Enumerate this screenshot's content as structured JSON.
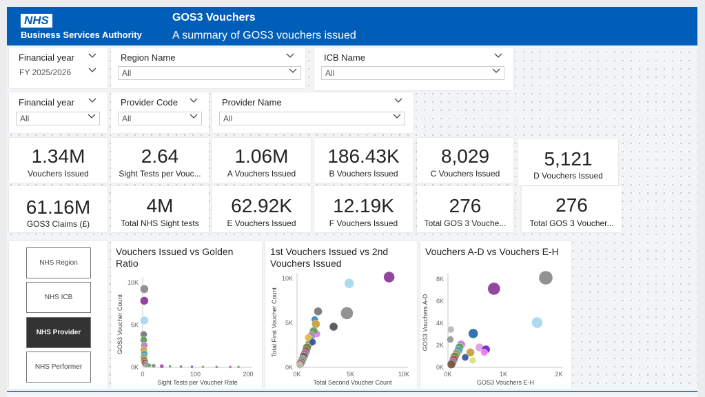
{
  "header": {
    "logo": "NHS",
    "org": "Business Services Authority",
    "title": "GOS3 Vouchers",
    "subtitle": "A summary of GOS3 vouchers issued"
  },
  "slicers_row1": [
    {
      "label": "Financial year",
      "value": "FY 2025/2026"
    },
    {
      "label": "Region Name",
      "value": "All"
    },
    {
      "label": "ICB Name",
      "value": "All"
    }
  ],
  "slicers_row2": [
    {
      "label": "Financial year",
      "value": "All"
    },
    {
      "label": "Provider Code",
      "value": "All"
    },
    {
      "label": "Provider Name",
      "value": "All"
    }
  ],
  "kpis_row1": [
    {
      "value": "1.34M",
      "label": "Vouchers Issued"
    },
    {
      "value": "2.64",
      "label": "Sight Tests per Vouc..."
    },
    {
      "value": "1.06M",
      "label": "A Vouchers Issued"
    },
    {
      "value": "186.43K",
      "label": "B Vouchers Issued"
    },
    {
      "value": "8,029",
      "label": "C Vouchers Issued"
    },
    {
      "value": "5,121",
      "label": "D Vouchers Issued"
    }
  ],
  "kpis_row2": [
    {
      "value": "61.16M",
      "label": "GOS3 Claims (£)"
    },
    {
      "value": "4M",
      "label": "Total NHS Sight tests"
    },
    {
      "value": "62.92K",
      "label": "E Vouchers Issued"
    },
    {
      "value": "12.19K",
      "label": "F Vouchers Issued"
    },
    {
      "value": "276",
      "label": "Total GOS 3 Vouche..."
    },
    {
      "value": "276",
      "label": "Total GOS 3 Voucher..."
    }
  ],
  "nav": {
    "buttons": [
      "NHS Region",
      "NHS ICB",
      "NHS Provider",
      "NHS Performer"
    ],
    "active": "NHS Provider"
  },
  "chart_data": [
    {
      "type": "scatter",
      "title": "Vouchers Issued vs Golden Ratio",
      "xlabel": "Sight Tests per Voucher Rate",
      "ylabel": "GOS3 Voucher Count",
      "xlim": [
        0,
        200
      ],
      "ylim": [
        0,
        11000
      ],
      "xticks": [
        "0",
        "100",
        "200"
      ],
      "yticks": [
        "0K",
        "5K",
        "10K"
      ],
      "points": [
        {
          "x": 3,
          "y": 10000,
          "r": 6,
          "c": "#8c8c8c"
        },
        {
          "x": 3,
          "y": 8500,
          "r": 6,
          "c": "#8e3b9a"
        },
        {
          "x": 3,
          "y": 6000,
          "r": 6,
          "c": "#a8d8f0"
        },
        {
          "x": 2,
          "y": 4200,
          "r": 5,
          "c": "#7a7a7a"
        },
        {
          "x": 2,
          "y": 3500,
          "r": 5,
          "c": "#5aa05a"
        },
        {
          "x": 3,
          "y": 2800,
          "r": 5,
          "c": "#c080c0"
        },
        {
          "x": 2,
          "y": 2200,
          "r": 5,
          "c": "#d0a040"
        },
        {
          "x": 3,
          "y": 1700,
          "r": 5,
          "c": "#4aa0c0"
        },
        {
          "x": 2,
          "y": 1300,
          "r": 5,
          "c": "#a0a070"
        },
        {
          "x": 3,
          "y": 900,
          "r": 5,
          "c": "#6a8a40"
        },
        {
          "x": 4,
          "y": 600,
          "r": 5,
          "c": "#b05050"
        },
        {
          "x": 5,
          "y": 400,
          "r": 4,
          "c": "#777"
        },
        {
          "x": 8,
          "y": 300,
          "r": 4,
          "c": "#9a9a9a"
        },
        {
          "x": 12,
          "y": 250,
          "r": 3,
          "c": "#6a6"
        },
        {
          "x": 20,
          "y": 200,
          "r": 3,
          "c": "#888"
        },
        {
          "x": 35,
          "y": 150,
          "r": 3,
          "c": "#a5a"
        },
        {
          "x": 50,
          "y": 120,
          "r": 2,
          "c": "#5a5"
        },
        {
          "x": 70,
          "y": 100,
          "r": 2,
          "c": "#777"
        },
        {
          "x": 90,
          "y": 80,
          "r": 2,
          "c": "#66a"
        },
        {
          "x": 110,
          "y": 70,
          "r": 2,
          "c": "#8a5"
        },
        {
          "x": 135,
          "y": 60,
          "r": 2,
          "c": "#888"
        },
        {
          "x": 160,
          "y": 60,
          "r": 2,
          "c": "#a6c"
        },
        {
          "x": 175,
          "y": 50,
          "r": 2,
          "c": "#6a6"
        }
      ]
    },
    {
      "type": "scatter",
      "title": "1st Vouchers Issued vs 2nd Vouchers Issued",
      "xlabel": "Total Second Voucher Count",
      "ylabel": "Total First Voucher Count",
      "xlim": [
        0,
        10000
      ],
      "ylim": [
        0,
        10000
      ],
      "xticks": [
        "0K",
        "5K",
        "10K"
      ],
      "yticks": [
        "0K",
        "5K",
        "10K"
      ],
      "points": [
        {
          "x": 8300,
          "y": 10000,
          "r": 8,
          "c": "#8e3b9a"
        },
        {
          "x": 4700,
          "y": 9300,
          "r": 7,
          "c": "#a8d8f0"
        },
        {
          "x": 4500,
          "y": 6000,
          "r": 9,
          "c": "#8c8c8c"
        },
        {
          "x": 1900,
          "y": 6200,
          "r": 6,
          "c": "#7a7a7a"
        },
        {
          "x": 3300,
          "y": 4500,
          "r": 6,
          "c": "#555"
        },
        {
          "x": 1600,
          "y": 5300,
          "r": 5,
          "c": "#3a8ad0"
        },
        {
          "x": 1700,
          "y": 4800,
          "r": 6,
          "c": "#d0a040"
        },
        {
          "x": 1800,
          "y": 3700,
          "r": 5,
          "c": "#e080e0"
        },
        {
          "x": 1500,
          "y": 4000,
          "r": 6,
          "c": "#5aa05a"
        },
        {
          "x": 1300,
          "y": 3500,
          "r": 6,
          "c": "#c080c0"
        },
        {
          "x": 1200,
          "y": 3000,
          "r": 6,
          "c": "#4aa0c0"
        },
        {
          "x": 1100,
          "y": 2600,
          "r": 6,
          "c": "#a0a070"
        },
        {
          "x": 900,
          "y": 2200,
          "r": 6,
          "c": "#6a8a40"
        },
        {
          "x": 800,
          "y": 1800,
          "r": 6,
          "c": "#b05050"
        },
        {
          "x": 700,
          "y": 1500,
          "r": 6,
          "c": "#8080c0"
        },
        {
          "x": 600,
          "y": 1200,
          "r": 6,
          "c": "#7a5a3a"
        },
        {
          "x": 500,
          "y": 900,
          "r": 6,
          "c": "#999"
        },
        {
          "x": 400,
          "y": 600,
          "r": 6,
          "c": "#5a8a8a"
        },
        {
          "x": 300,
          "y": 400,
          "r": 6,
          "c": "#a07050"
        },
        {
          "x": 250,
          "y": 250,
          "r": 5,
          "c": "#bbb"
        },
        {
          "x": 1000,
          "y": 3300,
          "r": 5,
          "c": "#e0c040"
        },
        {
          "x": 1400,
          "y": 2800,
          "r": 5,
          "c": "#3a5a9a"
        }
      ]
    },
    {
      "type": "scatter",
      "title": "Vouchers A-D vs Vouchers E-H",
      "xlabel": "GOS3 Vouchers E-H",
      "ylabel": "GOS3 Vouchers A-D",
      "xlim": [
        0,
        2000
      ],
      "ylim": [
        0,
        9000
      ],
      "xticks": [
        "0K",
        "1K",
        "2K"
      ],
      "yticks": [
        "0K",
        "2K",
        "4K",
        "6K",
        "8K"
      ],
      "points": [
        {
          "x": 1700,
          "y": 9000,
          "r": 10,
          "c": "#8c8c8c"
        },
        {
          "x": 800,
          "y": 7900,
          "r": 9,
          "c": "#8e3b9a"
        },
        {
          "x": 1550,
          "y": 4500,
          "r": 8,
          "c": "#a8d8f0"
        },
        {
          "x": 440,
          "y": 3400,
          "r": 7,
          "c": "#2a6ab0"
        },
        {
          "x": 550,
          "y": 2000,
          "r": 6,
          "c": "#e0a0e0"
        },
        {
          "x": 660,
          "y": 1800,
          "r": 6,
          "c": "#6a2ad0"
        },
        {
          "x": 630,
          "y": 1500,
          "r": 5,
          "c": "#f080f0"
        },
        {
          "x": 390,
          "y": 1500,
          "r": 6,
          "c": "#c8a040"
        },
        {
          "x": 430,
          "y": 700,
          "r": 5,
          "c": "#dde080"
        },
        {
          "x": 230,
          "y": 2300,
          "r": 6,
          "c": "#d080d0"
        },
        {
          "x": 200,
          "y": 2000,
          "r": 6,
          "c": "#5aa05a"
        },
        {
          "x": 180,
          "y": 1700,
          "r": 6,
          "c": "#4aa0c0"
        },
        {
          "x": 150,
          "y": 1400,
          "r": 6,
          "c": "#a0a070"
        },
        {
          "x": 120,
          "y": 1100,
          "r": 6,
          "c": "#6a8a40"
        },
        {
          "x": 100,
          "y": 800,
          "r": 6,
          "c": "#b05050"
        },
        {
          "x": 80,
          "y": 500,
          "r": 6,
          "c": "#8080c0"
        },
        {
          "x": 60,
          "y": 300,
          "r": 6,
          "c": "#7a5a3a"
        },
        {
          "x": 40,
          "y": 2800,
          "r": 5,
          "c": "#999"
        },
        {
          "x": 50,
          "y": 3800,
          "r": 5,
          "c": "#bbb"
        },
        {
          "x": 300,
          "y": 1000,
          "r": 5,
          "c": "#3a5a9a"
        }
      ]
    }
  ]
}
